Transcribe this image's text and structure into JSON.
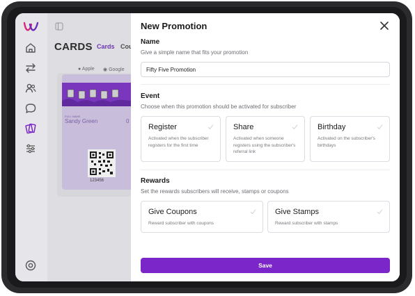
{
  "background_app": {
    "page_title": "CARDS",
    "tabs": [
      "Cards",
      "Cou"
    ],
    "platforms": [
      "Apple",
      "Google"
    ],
    "card": {
      "field_label": "FULL NAME",
      "holder_name": "Sandy Green",
      "stamp_count": "0",
      "code_number": "123456"
    },
    "sidebar_icons": [
      "logo-icon",
      "home-icon",
      "transfer-icon",
      "users-icon",
      "chat-icon",
      "cards-icon",
      "settings-sliders-icon",
      "help-icon"
    ]
  },
  "modal": {
    "title": "New Promotion",
    "name_section": {
      "title": "Name",
      "subtitle": "Give a simple name that fits your promotion",
      "value": "Fifty Five Promotion"
    },
    "event_section": {
      "title": "Event",
      "subtitle": "Choose when this promotion should be activated for subscriber",
      "options": [
        {
          "label": "Register",
          "description": "Activated when the subscriber registers for the first time"
        },
        {
          "label": "Share",
          "description": "Activated when someone registers using the subscriber's referral link"
        },
        {
          "label": "Birthday",
          "description": "Activated on the subscriber's birthdays"
        }
      ]
    },
    "rewards_section": {
      "title": "Rewards",
      "subtitle": "Set the rewards subscribers will receive, stamps or coupons",
      "options": [
        {
          "label": "Give Coupons",
          "description": "Reward subscriber with coupons"
        },
        {
          "label": "Give Stamps",
          "description": "Reward subscriber with stamps"
        }
      ]
    },
    "save_label": "Save"
  },
  "colors": {
    "accent": "#7a26c8",
    "device_frame": "#2b2b2e",
    "card_purple": "#7a2ec7"
  }
}
